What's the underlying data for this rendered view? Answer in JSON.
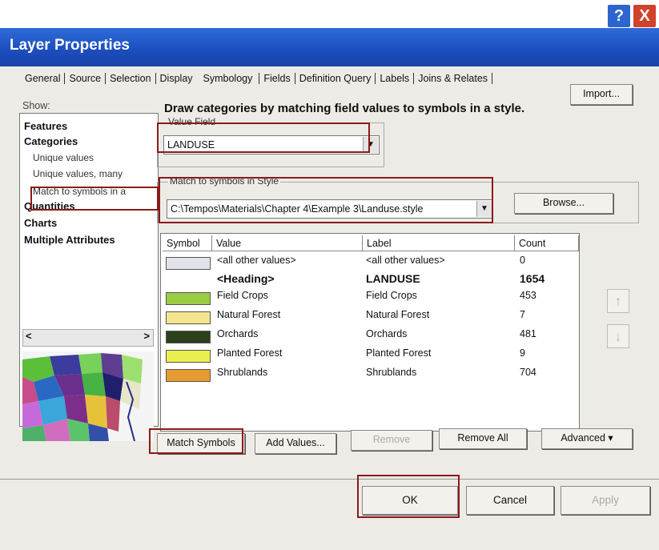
{
  "window": {
    "title": "Layer Properties",
    "help_glyph": "?",
    "close_glyph": "X"
  },
  "tabs": [
    "General",
    "Source",
    "Selection",
    "Display",
    "Symbology",
    "Fields",
    "Definition Query",
    "Labels",
    "Joins & Relates"
  ],
  "show": {
    "label": "Show:",
    "items": [
      {
        "label": "Features",
        "bold": true
      },
      {
        "label": "Categories",
        "bold": true
      },
      {
        "label": "Unique values",
        "bold": false
      },
      {
        "label": "Unique values, many",
        "bold": false
      },
      {
        "label": "Match to symbols in a",
        "bold": false
      },
      {
        "label": "Quantities",
        "bold": true
      },
      {
        "label": "Charts",
        "bold": true
      },
      {
        "label": "Multiple Attributes",
        "bold": true
      }
    ],
    "scroll_left": "<",
    "scroll_right": ">"
  },
  "heading": "Draw categories by matching field values to symbols in a style.",
  "import_label": "Import...",
  "value_field": {
    "group_label": "Value Field",
    "value": "LANDUSE"
  },
  "style": {
    "group_label": "Match to symbols in Style",
    "value": "C:\\Tempos\\Materials\\Chapter 4\\Example 3\\Landuse.style",
    "browse_label": "Browse..."
  },
  "table": {
    "headers": {
      "symbol": "Symbol",
      "value": "Value",
      "label": "Label",
      "count": "Count"
    },
    "rows": [
      {
        "value": "<all other values>",
        "label": "<all other values>",
        "count": "0",
        "color": "#e2e2ea",
        "bold": false
      },
      {
        "value": "<Heading>",
        "label": "LANDUSE",
        "count": "1654",
        "color": "",
        "bold": true
      },
      {
        "value": "Field Crops",
        "label": "Field Crops",
        "count": "453",
        "color": "#9acd44",
        "bold": false
      },
      {
        "value": "Natural Forest",
        "label": "Natural Forest",
        "count": "7",
        "color": "#f2e58e",
        "bold": false
      },
      {
        "value": "Orchards",
        "label": "Orchards",
        "count": "481",
        "color": "#2e3f1c",
        "bold": false
      },
      {
        "value": "Planted Forest",
        "label": "Planted Forest",
        "count": "9",
        "color": "#e9ef4d",
        "bold": false
      },
      {
        "value": "Shrublands",
        "label": "Shrublands",
        "count": "704",
        "color": "#e69a2f",
        "bold": false
      }
    ]
  },
  "side_buttons": {
    "up": "↑",
    "down": "↓"
  },
  "action_buttons": {
    "match_symbols": "Match Symbols",
    "add_values": "Add Values...",
    "remove": "Remove",
    "remove_all": "Remove All",
    "advanced": "Advanced",
    "advanced_arrow": "▾"
  },
  "footer": {
    "ok": "OK",
    "cancel": "Cancel",
    "apply": "Apply"
  },
  "colors": {
    "titlebar": "#1d4fc0",
    "highlight": "#8b1a1a"
  }
}
